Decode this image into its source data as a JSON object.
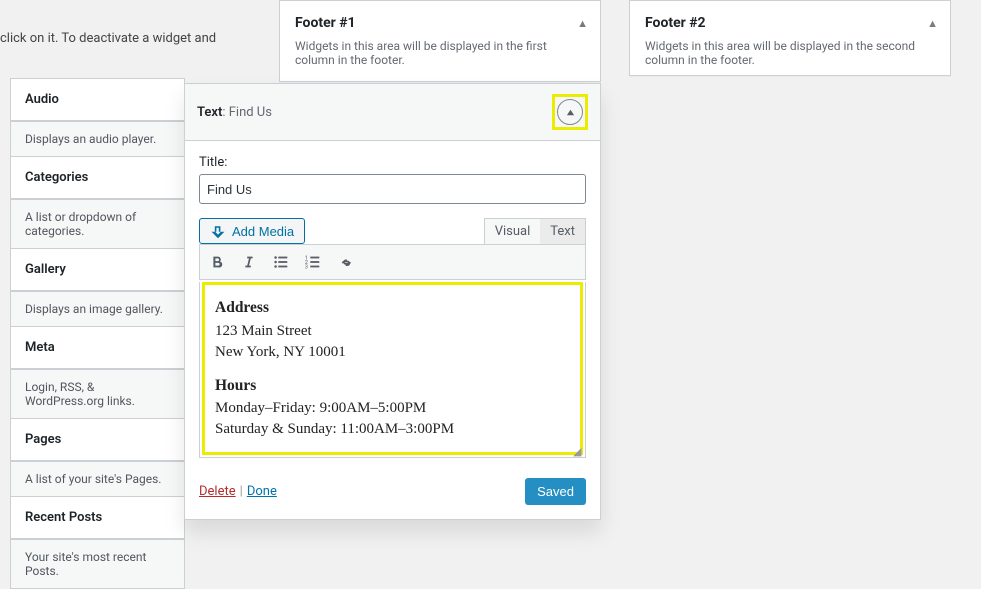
{
  "fragment_text": "click on it. To deactivate a widget and",
  "available_widgets": [
    {
      "title": "Audio",
      "desc": "Displays an audio player."
    },
    {
      "title": "Categories",
      "desc": "A list or dropdown of categories."
    },
    {
      "title": "Gallery",
      "desc": "Displays an image gallery."
    },
    {
      "title": "Meta",
      "desc": "Login, RSS, & WordPress.org links."
    },
    {
      "title": "Pages",
      "desc": "A list of your site's Pages."
    },
    {
      "title": "Recent Posts",
      "desc": "Your site's most recent Posts."
    }
  ],
  "sidebar_areas": {
    "footer1": {
      "title": "Footer #1",
      "desc": "Widgets in this area will be displayed in the first column in the footer."
    },
    "footer2": {
      "title": "Footer #2",
      "desc": "Widgets in this area will be displayed in the second column in the footer."
    }
  },
  "widget_open": {
    "type_label": "Text",
    "instance_label": "Find Us",
    "title_label": "Title:",
    "title_value": "Find Us",
    "add_media_label": "Add Media",
    "tabs": {
      "visual": "Visual",
      "text": "Text"
    },
    "content": {
      "heading1": "Address",
      "line1": "123 Main Street",
      "line2": "New York, NY 10001",
      "heading2": "Hours",
      "line3": "Monday–Friday: 9:00AM–5:00PM",
      "line4": "Saturday & Sunday: 11:00AM–3:00PM"
    },
    "actions": {
      "delete": "Delete",
      "done": "Done",
      "saved": "Saved"
    }
  }
}
